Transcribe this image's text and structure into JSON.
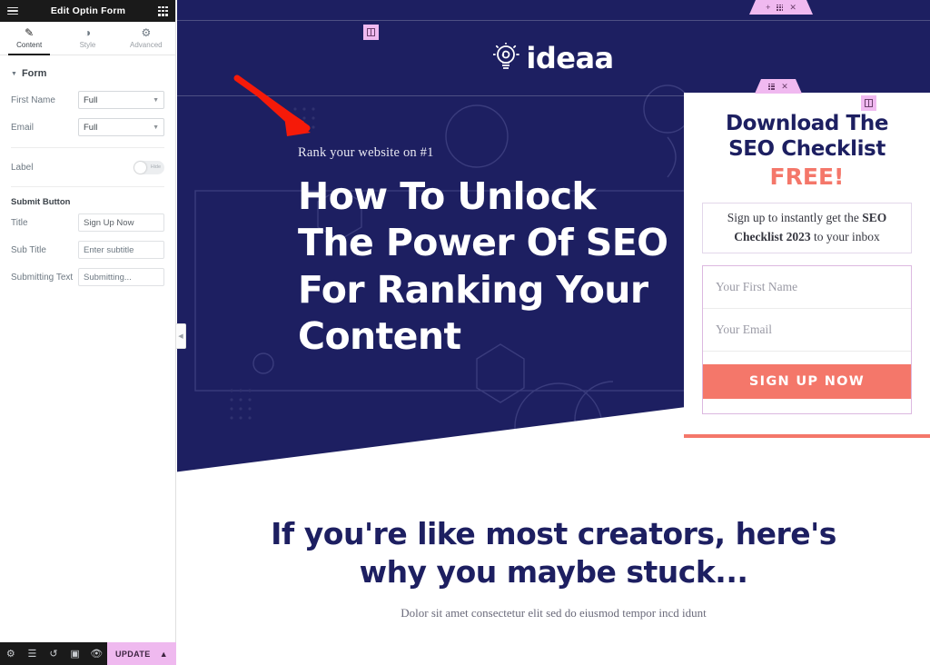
{
  "panel": {
    "header": {
      "title": "Edit Optin Form",
      "menu_icon": "hamburger-icon",
      "apps_icon": "grid-icon"
    },
    "tabs": [
      {
        "label": "Content",
        "icon": "pencil-icon",
        "active": true
      },
      {
        "label": "Style",
        "icon": "contrast-icon",
        "active": false
      },
      {
        "label": "Advanced",
        "icon": "gear-icon",
        "active": false
      }
    ],
    "form_section": {
      "title": "Form",
      "fields": [
        {
          "label": "First Name",
          "value": "Full"
        },
        {
          "label": "Email",
          "value": "Full"
        }
      ],
      "label_toggle": {
        "label": "Label",
        "state": "Hide"
      }
    },
    "submit_section": {
      "title": "Submit Button",
      "rows": [
        {
          "label": "Title",
          "value": "Sign Up Now",
          "placeholder": ""
        },
        {
          "label": "Sub Title",
          "value": "",
          "placeholder": "Enter subtitle"
        },
        {
          "label": "Submitting Text",
          "value": "",
          "placeholder": "Submitting..."
        }
      ]
    },
    "footer": {
      "icons": [
        "settings-icon",
        "layers-icon",
        "history-icon",
        "responsive-icon",
        "preview-icon"
      ],
      "update_label": "UPDATE",
      "update_caret": "chevron-up-icon"
    },
    "collapse_icon": "chevron-left-icon"
  },
  "canvas": {
    "logo": {
      "text": "ideaa",
      "icon": "lightbulb-icon"
    },
    "hero": {
      "eyebrow": "Rank your website on #1",
      "headline": "How To Unlock The Power Of SEO For Ranking Your Content"
    },
    "optin": {
      "heading_line1": "Download The",
      "heading_line2": "SEO Checklist",
      "free": "FREE!",
      "subtext_prefix": "Sign up to instantly get the ",
      "subtext_bold1": "SEO Checklist 2023",
      "subtext_suffix": " to your inbox",
      "first_name_placeholder": "Your First Name",
      "email_placeholder": "Your Email",
      "submit_label": "SIGN UP NOW"
    },
    "lower": {
      "heading": "If you're like most creators, here's why you maybe stuck...",
      "subheading": "Dolor sit amet consectetur elit sed do eiusmod tempor incd idunt"
    },
    "handles": {
      "section_top": {
        "add_icon": "plus-icon",
        "drag_icon": "grid-icon",
        "close_icon": "close-icon"
      },
      "section_mid": {
        "drag_icon": "grid-icon",
        "close_icon": "close-icon"
      },
      "column_icon": "column-icon",
      "edit_icon": "pencil-icon"
    }
  },
  "colors": {
    "navy": "#1d1f61",
    "coral": "#f4776a",
    "pink_handle": "#f0b9f0",
    "panel_dark": "#1a1a1a",
    "arrow_red": "#f51a09"
  }
}
